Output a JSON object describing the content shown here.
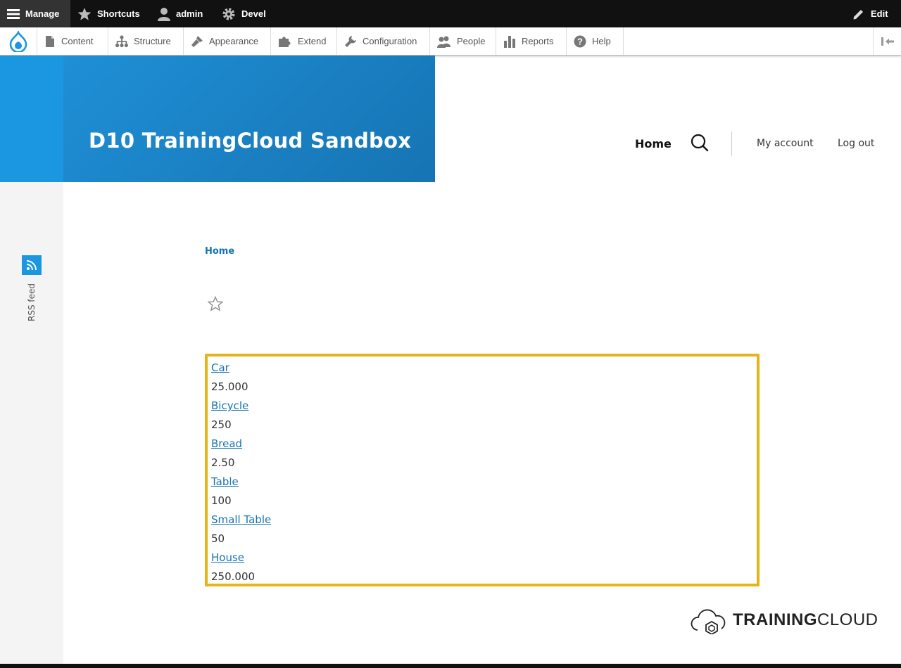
{
  "toolbar": {
    "manage": "Manage",
    "shortcuts": "Shortcuts",
    "user": "admin",
    "devel": "Devel",
    "edit": "Edit"
  },
  "admin_menu": {
    "items": [
      {
        "label": "Content",
        "icon": "file-icon"
      },
      {
        "label": "Structure",
        "icon": "sitemap-icon"
      },
      {
        "label": "Appearance",
        "icon": "paintbrush-icon"
      },
      {
        "label": "Extend",
        "icon": "puzzle-icon"
      },
      {
        "label": "Configuration",
        "icon": "wrench-icon"
      },
      {
        "label": "People",
        "icon": "people-icon"
      },
      {
        "label": "Reports",
        "icon": "bar-chart-icon"
      },
      {
        "label": "Help",
        "icon": "help-icon"
      }
    ]
  },
  "header": {
    "site_name": "D10 TrainingCloud Sandbox",
    "nav_home": "Home",
    "my_account": "My account",
    "log_out": "Log out"
  },
  "sidebar": {
    "rss_label": "RSS feed"
  },
  "breadcrumb": {
    "home": "Home"
  },
  "products": [
    {
      "name": "Car",
      "price": "25.000"
    },
    {
      "name": "Bicycle",
      "price": "250"
    },
    {
      "name": "Bread",
      "price": "2.50"
    },
    {
      "name": "Table",
      "price": "100"
    },
    {
      "name": "Small Table",
      "price": "50"
    },
    {
      "name": "House",
      "price": "250.000"
    }
  ],
  "footer": {
    "logo_bold": "TRAINING",
    "logo_light": "CLOUD"
  },
  "colors": {
    "brand_blue": "#1a97e0",
    "link_blue": "#1674b3",
    "highlight_border": "#e7b316",
    "toolbar_black": "#111111"
  }
}
